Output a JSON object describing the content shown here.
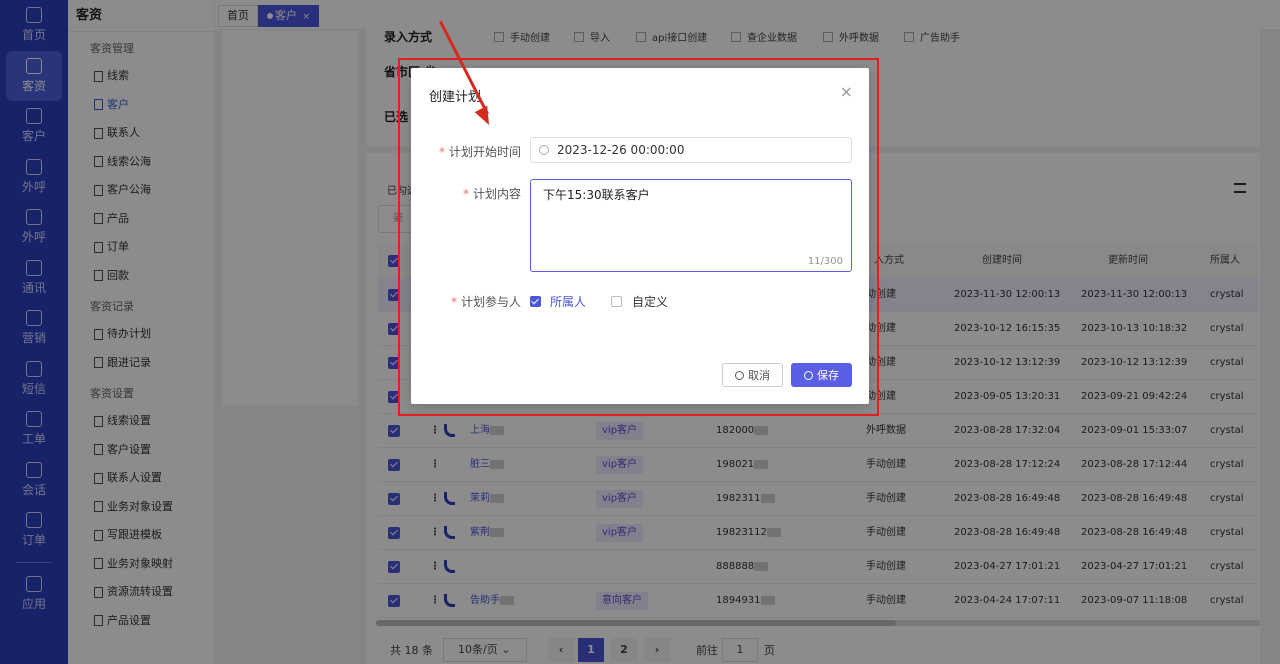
{
  "rail": [
    {
      "label": "首页",
      "icon": "home-icon"
    },
    {
      "label": "客资",
      "icon": "people-icon",
      "active": true
    },
    {
      "label": "客户",
      "icon": "person-icon"
    },
    {
      "label": "外呼",
      "icon": "phone-out-icon"
    },
    {
      "label": "外呼",
      "icon": "phone-in-icon"
    },
    {
      "label": "通讯",
      "icon": "contacts-icon"
    },
    {
      "label": "营销",
      "icon": "marketing-icon"
    },
    {
      "label": "短信",
      "icon": "sms-icon"
    },
    {
      "label": "工单",
      "icon": "ticket-icon"
    },
    {
      "label": "会话",
      "icon": "chat-icon"
    },
    {
      "label": "订单",
      "icon": "order-icon"
    },
    {
      "label": "应用",
      "icon": "apps-icon"
    }
  ],
  "subnav": {
    "title": "客资",
    "groups": [
      {
        "label": "客资管理",
        "items": [
          "线索",
          "客户",
          "联系人",
          "线索公海",
          "客户公海",
          "产品",
          "订单",
          "回款"
        ]
      },
      {
        "label": "客资记录",
        "items": [
          "待办计划",
          "跟进记录"
        ]
      },
      {
        "label": "客资设置",
        "items": [
          "线索设置",
          "客户设置",
          "联系人设置",
          "业务对象设置",
          "写跟进模板",
          "业务对象映射",
          "资源流转设置",
          "产品设置"
        ]
      }
    ],
    "active_item": "客户"
  },
  "tabs": [
    {
      "label": "首页"
    },
    {
      "label": "客户",
      "close": "×"
    }
  ],
  "filter": {
    "entry_label": "录入方式",
    "entry_options": [
      "手动创建",
      "导入",
      "api接口创建",
      "查企业数据",
      "外呼数据",
      "广告助手"
    ],
    "region_label": "省市区",
    "region_suffix": "省",
    "selected_label": "已选"
  },
  "table": {
    "selected_prefix": "已勾选",
    "search_placeholder": "姿",
    "headers": {
      "entry": "入方式",
      "created": "创建时间",
      "updated": "更新时间",
      "owner": "所属人"
    },
    "rows": [
      {
        "name": "",
        "tag": "",
        "phone": "",
        "entry": "动创建",
        "created": "2023-11-30 12:00:13",
        "updated": "2023-11-30 12:00:13",
        "owner": "crystal"
      },
      {
        "name": "",
        "tag": "",
        "phone": "",
        "entry": "动创建",
        "created": "2023-10-12 16:15:35",
        "updated": "2023-10-13 10:18:32",
        "owner": "crystal"
      },
      {
        "name": "",
        "tag": "",
        "phone": "",
        "entry": "动创建",
        "created": "2023-10-12 13:12:39",
        "updated": "2023-10-12 13:12:39",
        "owner": "crystal"
      },
      {
        "name": "",
        "tag": "",
        "phone": "",
        "entry": "动创建",
        "created": "2023-09-05 13:20:31",
        "updated": "2023-09-21 09:42:24",
        "owner": "crystal"
      },
      {
        "name": "上海",
        "tag": "vip客户",
        "phone": "182000",
        "entry": "外呼数据",
        "created": "2023-08-28 17:32:04",
        "updated": "2023-09-01 15:33:07",
        "owner": "crystal"
      },
      {
        "name": "脏三",
        "tag": "vip客户",
        "phone": "198021",
        "entry": "手动创建",
        "created": "2023-08-28 17:12:24",
        "updated": "2023-08-28 17:12:44",
        "owner": "crystal"
      },
      {
        "name": "茉莉",
        "tag": "vip客户",
        "phone": "1982311",
        "entry": "手动创建",
        "created": "2023-08-28 16:49:48",
        "updated": "2023-08-28 16:49:48",
        "owner": "crystal"
      },
      {
        "name": "紫荆",
        "tag": "vip客户",
        "phone": "19823112",
        "entry": "手动创建",
        "created": "2023-08-28 16:49:48",
        "updated": "2023-08-28 16:49:48",
        "owner": "crystal"
      },
      {
        "name": "",
        "tag": "",
        "phone": "888888",
        "entry": "手动创建",
        "created": "2023-04-27 17:01:21",
        "updated": "2023-04-27 17:01:21",
        "owner": "crystal"
      },
      {
        "name": "告助手",
        "tag": "意向客户",
        "phone": "1894931",
        "entry": "手动创建",
        "created": "2023-04-24 17:07:11",
        "updated": "2023-09-07 11:18:08",
        "owner": "crystal"
      }
    ]
  },
  "pager": {
    "total": "共 18 条",
    "size": "10条/页",
    "pages": [
      "1",
      "2"
    ],
    "goto_label": "前往",
    "goto_value": "1",
    "goto_suffix": "页"
  },
  "modal": {
    "title": "创建计划",
    "close": "×",
    "start_label": "计划开始时间",
    "start_value": "2023-12-26 00:00:00",
    "content_label": "计划内容",
    "content_value": "下午15:30联系客户",
    "content_count": "11/300",
    "participants_label": "计划参与人",
    "opt_owner": "所属人",
    "opt_custom": "自定义",
    "cancel": "取消",
    "save": "保存",
    "required": "*"
  }
}
